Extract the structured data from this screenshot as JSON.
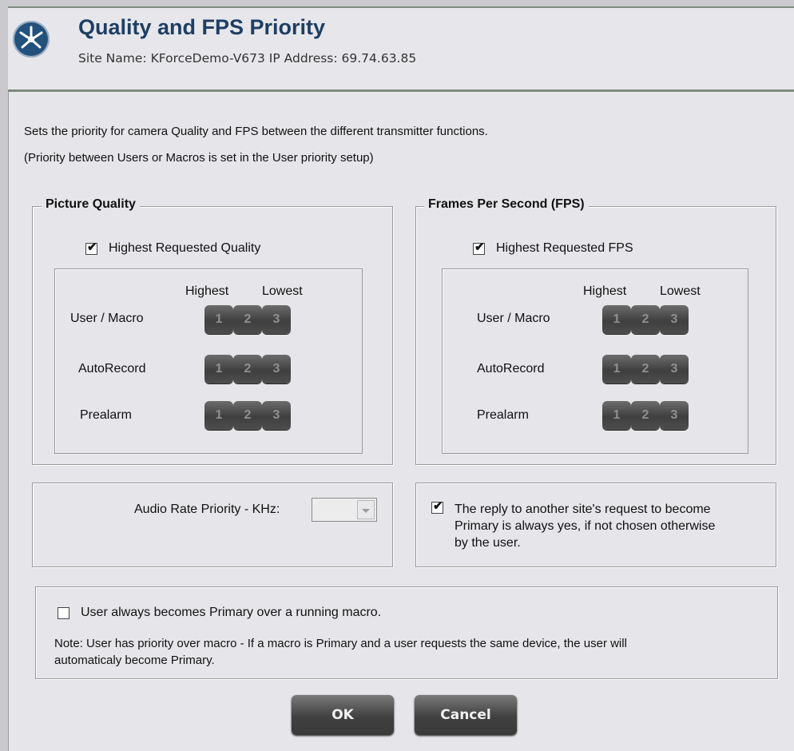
{
  "header": {
    "title": "Quality and FPS Priority",
    "subtitle": "Site Name: KForceDemo-V673   IP Address: 69.74.63.85",
    "logo_icon": "star-logo-icon"
  },
  "description": {
    "line1": "Sets the priority for camera Quality and FPS between the different transmitter functions.",
    "line2": "(Priority between Users or Macros is set  in the User priority setup)"
  },
  "picture_quality": {
    "title": "Picture Quality",
    "checkbox_label": "Highest Requested Quality",
    "checked": true,
    "highest_label": "Highest",
    "lowest_label": "Lowest",
    "rows": [
      {
        "label": "User / Macro",
        "buttons": [
          "1",
          "2",
          "3"
        ]
      },
      {
        "label": "AutoRecord",
        "buttons": [
          "1",
          "2",
          "3"
        ]
      },
      {
        "label": "Prealarm",
        "buttons": [
          "1",
          "2",
          "3"
        ]
      }
    ]
  },
  "fps": {
    "title": "Frames Per Second (FPS)",
    "checkbox_label": "Highest Requested FPS",
    "checked": true,
    "highest_label": "Highest",
    "lowest_label": "Lowest",
    "rows": [
      {
        "label": "User / Macro",
        "buttons": [
          "1",
          "2",
          "3"
        ]
      },
      {
        "label": "AutoRecord",
        "buttons": [
          "1",
          "2",
          "3"
        ]
      },
      {
        "label": "Prealarm",
        "buttons": [
          "1",
          "2",
          "3"
        ]
      }
    ]
  },
  "audio": {
    "label": "Audio Rate Priority - KHz:",
    "value": ""
  },
  "reply_option": {
    "checked": true,
    "line1": "The reply to another site's request to become",
    "line2": "Primary  is always yes, if not chosen otherwise",
    "line3": "by the user."
  },
  "user_primary": {
    "checked": false,
    "label": "User always becomes Primary over a running macro.",
    "note_line1": "Note: User has priority over macro - If a macro is Primary and a user requests the same device, the user will",
    "note_line2": "automaticaly become Primary."
  },
  "buttons": {
    "ok": "OK",
    "cancel": "Cancel"
  },
  "colors": {
    "title": "#1e3f63",
    "logo": "#23517c",
    "button_dark": "#404040",
    "background": "#e6e6ea"
  }
}
